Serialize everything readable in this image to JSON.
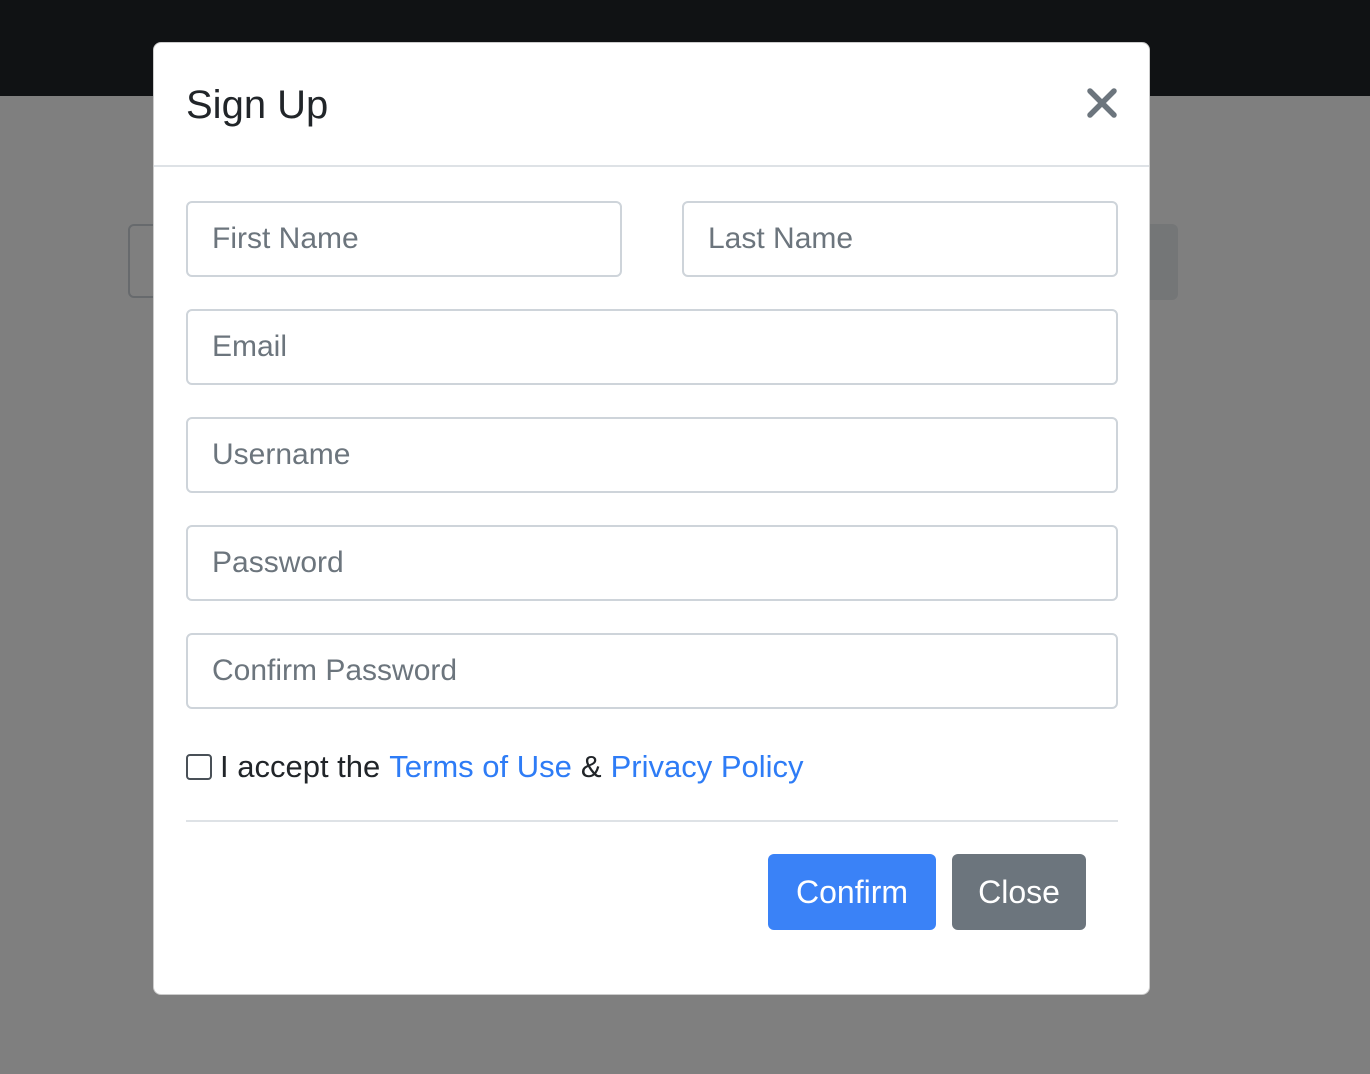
{
  "modal": {
    "title": "Sign Up",
    "close_icon": "close-icon"
  },
  "form": {
    "first_name_placeholder": "First Name",
    "last_name_placeholder": "Last Name",
    "email_placeholder": "Email",
    "username_placeholder": "Username",
    "password_placeholder": "Password",
    "confirm_password_placeholder": "Confirm Password",
    "terms_prefix": "I accept the",
    "terms_link": "Terms of Use",
    "terms_join": "&",
    "privacy_link": "Privacy Policy",
    "checkbox_checked": false
  },
  "footer": {
    "confirm_label": "Confirm",
    "close_label": "Close"
  },
  "colors": {
    "primary": "#3a82f7",
    "secondary": "#6c757d",
    "link": "#2e7cf6",
    "navbar": "#212529",
    "backdrop": "rgba(0,0,0,0.5)"
  }
}
